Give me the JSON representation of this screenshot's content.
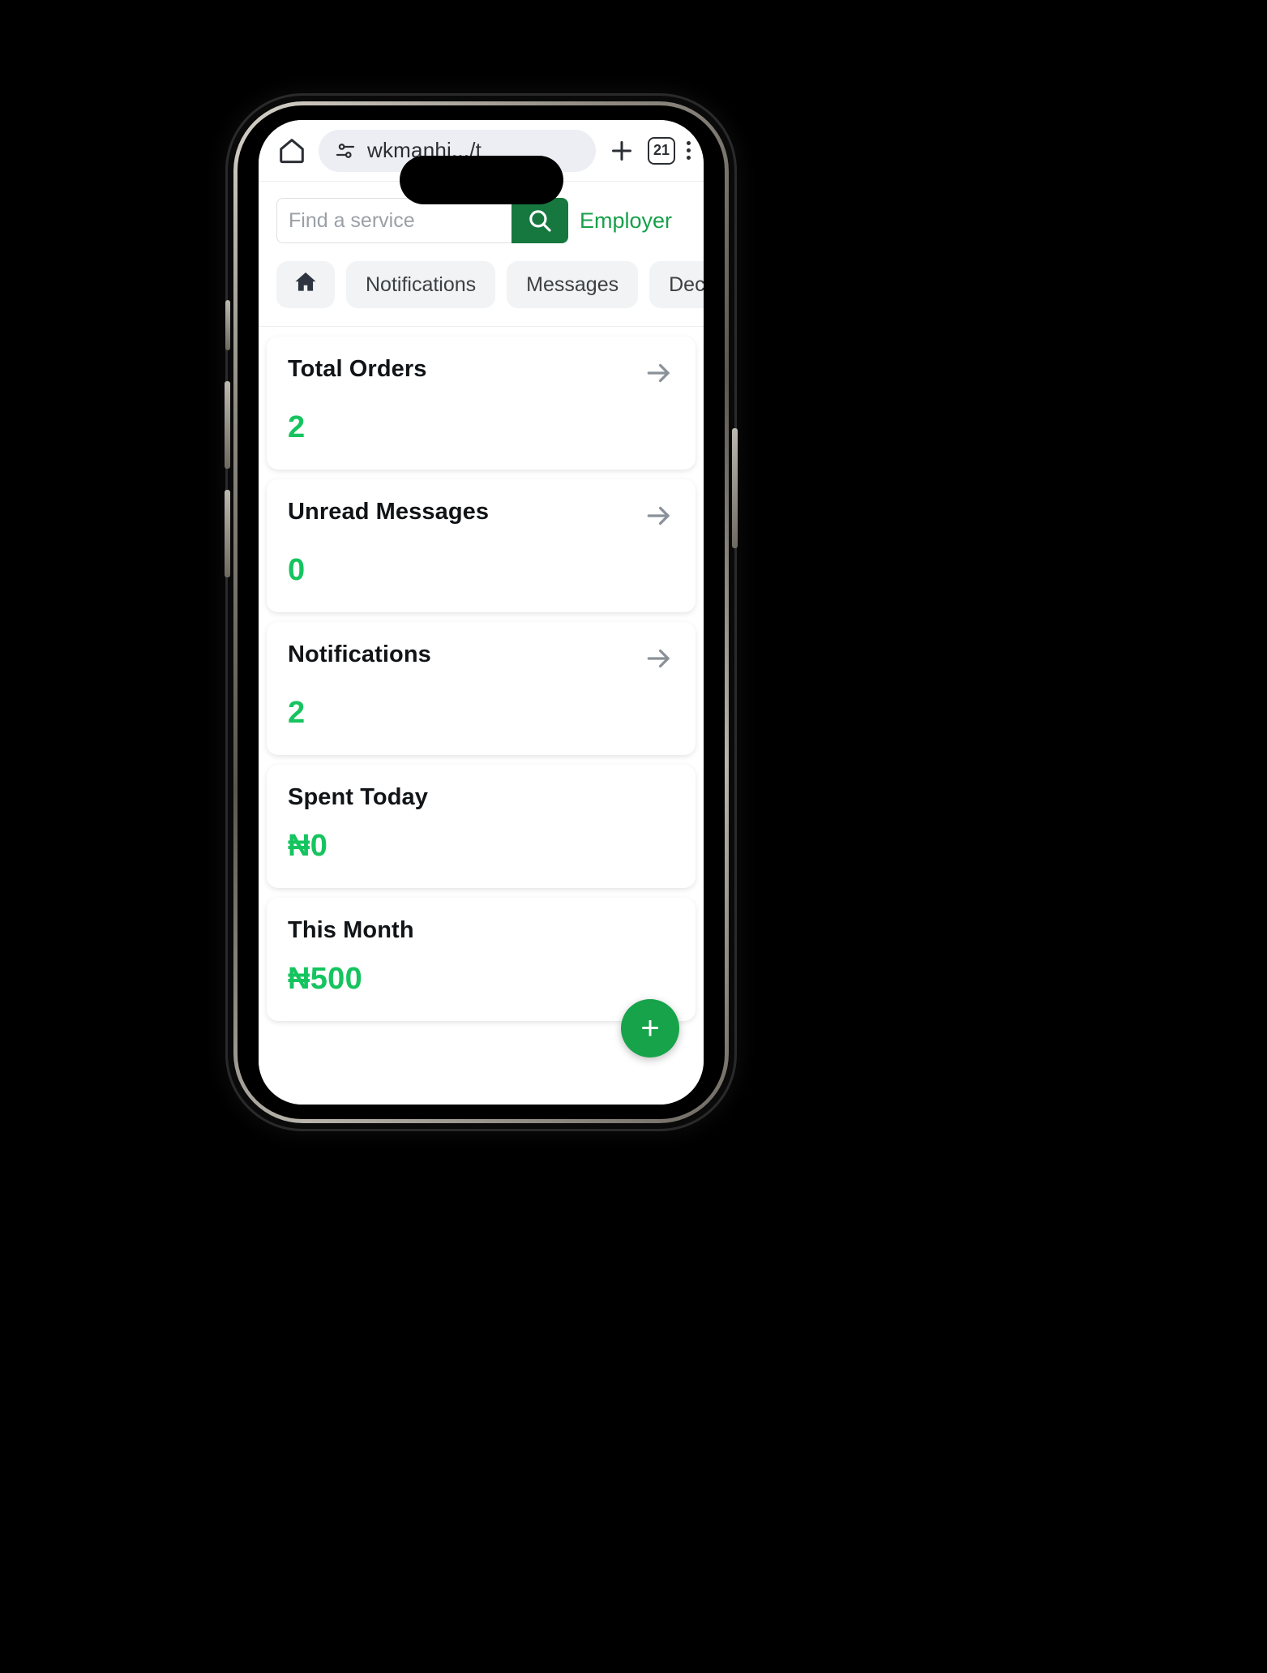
{
  "browser": {
    "home_icon": "home-icon",
    "site_info_icon": "site-settings-icon",
    "url_text": "wkmanhi.../t",
    "new_tab_label": "+",
    "tab_count": "21",
    "menu_icon": "kebab-menu-icon"
  },
  "search": {
    "placeholder": "Find a service",
    "value": "",
    "search_icon": "search-icon",
    "account_link": "Employer"
  },
  "tabs": [
    {
      "label": "",
      "icon": "home-icon",
      "active": true
    },
    {
      "label": "Notifications",
      "icon": "",
      "active": false
    },
    {
      "label": "Messages",
      "icon": "",
      "active": false
    },
    {
      "label": "Decorat",
      "icon": "",
      "active": false
    }
  ],
  "cards": [
    {
      "title": "Total Orders",
      "value": "2",
      "arrow": true
    },
    {
      "title": "Unread Messages",
      "value": "0",
      "arrow": true
    },
    {
      "title": "Notifications",
      "value": "2",
      "arrow": true
    },
    {
      "title": "Spent Today",
      "value": "₦0",
      "arrow": false
    },
    {
      "title": "This Month",
      "value": "₦500",
      "arrow": false
    }
  ],
  "fab": {
    "label": "+"
  },
  "colors": {
    "green_value": "#16c45f",
    "green_button": "#16783f",
    "green_link": "#17a04a",
    "fab_green": "#17a34a",
    "arrow_gray": "#8b9199"
  }
}
